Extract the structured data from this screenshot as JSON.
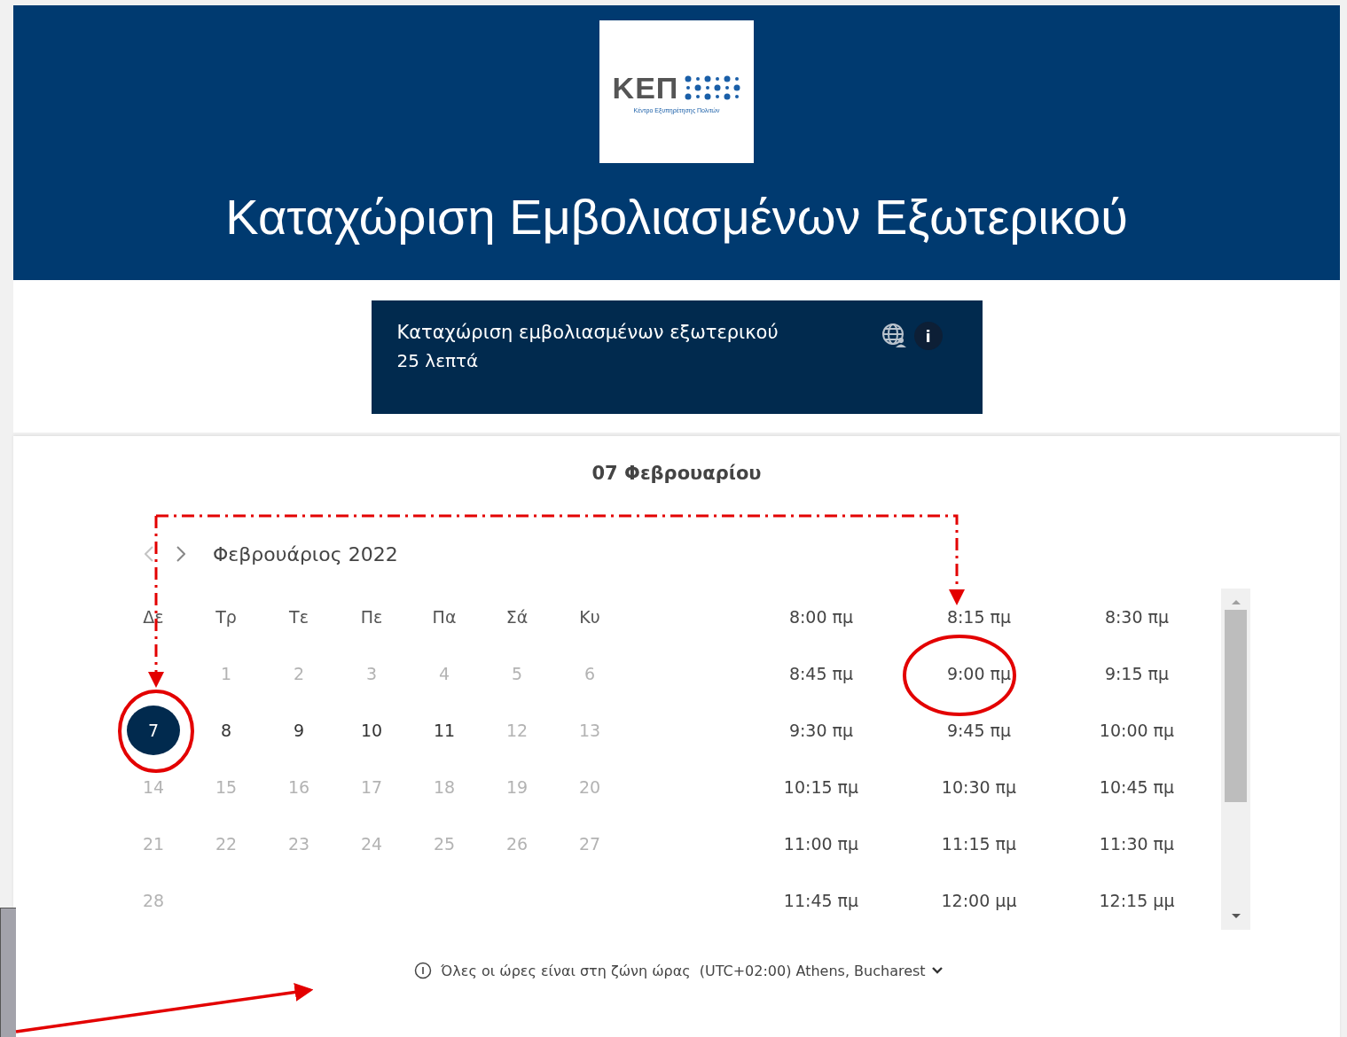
{
  "header": {
    "logo": {
      "mark": "ΚΕΠ",
      "subtitle": "Κέντρο Εξυπηρέτησης Πολιτών"
    },
    "title": "Καταχώριση Εμβολιασμένων Εξωτερικού"
  },
  "service": {
    "name": "Καταχώριση εμβολιασμένων εξωτερικού",
    "duration": "25 λεπτά",
    "info": "i"
  },
  "calendar": {
    "selected_date": "07 Φεβρουαρίου",
    "month": "Φεβρουάριος 2022",
    "weekdays": [
      "Δε",
      "Τρ",
      "Τε",
      "Πε",
      "Πα",
      "Σά",
      "Κυ"
    ],
    "weeks": [
      [
        {
          "label": "1",
          "disabled": true,
          "selected": false
        },
        {
          "label": "2",
          "disabled": true,
          "selected": false
        },
        {
          "label": "3",
          "disabled": true,
          "selected": false
        },
        {
          "label": "4",
          "disabled": true,
          "selected": false
        },
        {
          "label": "5",
          "disabled": true,
          "selected": false
        },
        {
          "label": "6",
          "disabled": true,
          "selected": false
        }
      ],
      [
        {
          "label": "7",
          "disabled": false,
          "selected": true
        },
        {
          "label": "8",
          "disabled": false,
          "selected": false
        },
        {
          "label": "9",
          "disabled": false,
          "selected": false
        },
        {
          "label": "10",
          "disabled": false,
          "selected": false
        },
        {
          "label": "11",
          "disabled": false,
          "selected": false
        },
        {
          "label": "12",
          "disabled": true,
          "selected": false
        },
        {
          "label": "13",
          "disabled": true,
          "selected": false
        }
      ],
      [
        {
          "label": "14",
          "disabled": true,
          "selected": false
        },
        {
          "label": "15",
          "disabled": true,
          "selected": false
        },
        {
          "label": "16",
          "disabled": true,
          "selected": false
        },
        {
          "label": "17",
          "disabled": true,
          "selected": false
        },
        {
          "label": "18",
          "disabled": true,
          "selected": false
        },
        {
          "label": "19",
          "disabled": true,
          "selected": false
        },
        {
          "label": "20",
          "disabled": true,
          "selected": false
        }
      ],
      [
        {
          "label": "21",
          "disabled": true,
          "selected": false
        },
        {
          "label": "22",
          "disabled": true,
          "selected": false
        },
        {
          "label": "23",
          "disabled": true,
          "selected": false
        },
        {
          "label": "24",
          "disabled": true,
          "selected": false
        },
        {
          "label": "25",
          "disabled": true,
          "selected": false
        },
        {
          "label": "26",
          "disabled": true,
          "selected": false
        },
        {
          "label": "27",
          "disabled": true,
          "selected": false
        }
      ],
      [
        {
          "label": "28",
          "disabled": true,
          "selected": false
        }
      ]
    ],
    "times": [
      "8:00 πμ",
      "8:15 πμ",
      "8:30 πμ",
      "8:45 πμ",
      "9:00 πμ",
      "9:15 πμ",
      "9:30 πμ",
      "9:45 πμ",
      "10:00 πμ",
      "10:15 πμ",
      "10:30 πμ",
      "10:45 πμ",
      "11:00 πμ",
      "11:15 πμ",
      "11:30 πμ",
      "11:45 πμ",
      "12:00 μμ",
      "12:15 μμ"
    ]
  },
  "footer": {
    "note": "Όλες οι ώρες είναι στη ζώνη ώρας",
    "timezone": "(UTC+02:00) Athens, Bucharest"
  }
}
